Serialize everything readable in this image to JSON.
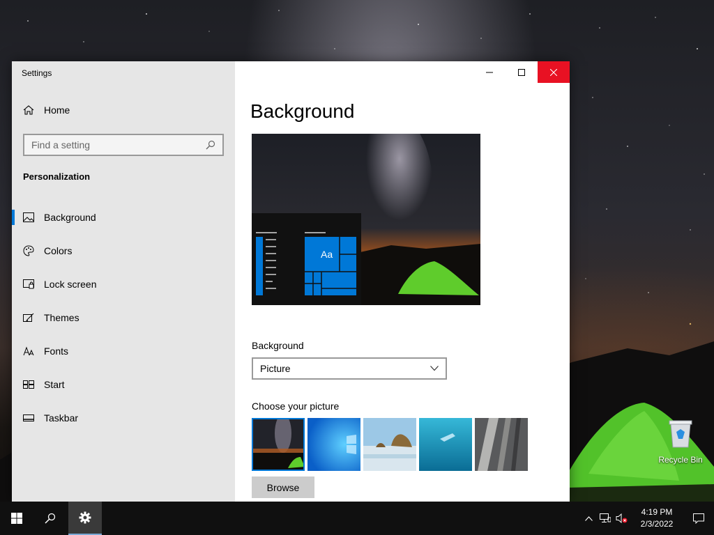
{
  "desktop": {
    "recycle_bin_label": "Recycle Bin"
  },
  "window": {
    "title": "Settings",
    "controls": {
      "minimize": "minimize-icon",
      "maximize": "maximize-icon",
      "close": "close-icon"
    }
  },
  "sidebar": {
    "home_label": "Home",
    "search_placeholder": "Find a setting",
    "section_title": "Personalization",
    "items": [
      {
        "label": "Background",
        "icon": "picture-icon",
        "active": true
      },
      {
        "label": "Colors",
        "icon": "palette-icon",
        "active": false
      },
      {
        "label": "Lock screen",
        "icon": "lock-screen-icon",
        "active": false
      },
      {
        "label": "Themes",
        "icon": "themes-icon",
        "active": false
      },
      {
        "label": "Fonts",
        "icon": "fonts-icon",
        "active": false
      },
      {
        "label": "Start",
        "icon": "start-icon",
        "active": false
      },
      {
        "label": "Taskbar",
        "icon": "taskbar-icon",
        "active": false
      }
    ]
  },
  "content": {
    "page_title": "Background",
    "preview_tile_text": "Aa",
    "background_label": "Background",
    "background_value": "Picture",
    "choose_label": "Choose your picture",
    "browse_label": "Browse"
  },
  "taskbar": {
    "time": "4:19 PM",
    "date": "2/3/2022"
  },
  "colors": {
    "accent": "#0078d7",
    "close_red": "#e81123"
  }
}
